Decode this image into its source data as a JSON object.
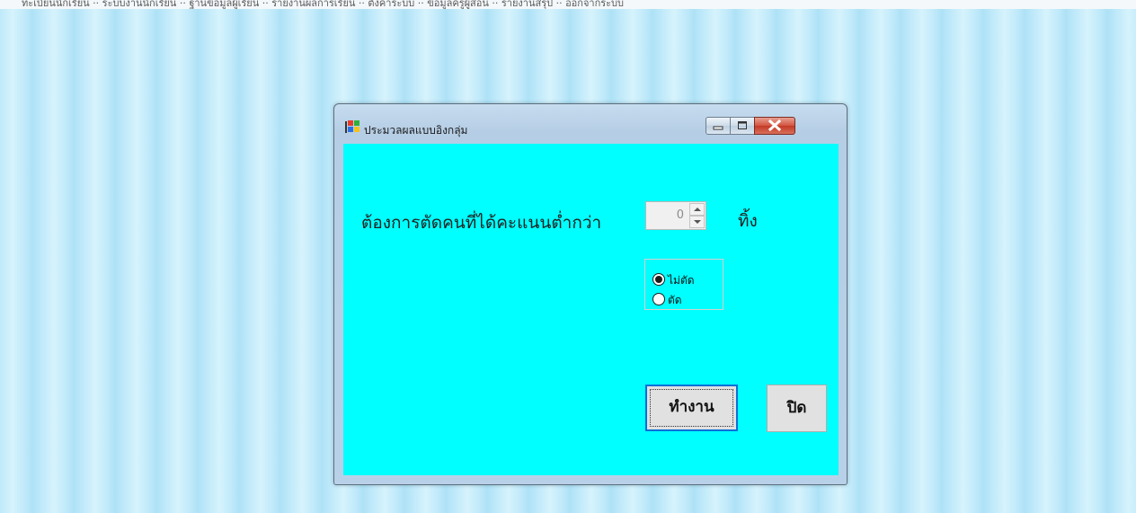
{
  "window": {
    "title": "ประมวลผลแบบอิงกลุ่ม",
    "icon": "windows-flag-icon",
    "controls": [
      "minimize-icon",
      "maximize-icon",
      "close-icon"
    ]
  },
  "form": {
    "prompt_label": "ต้องการตัดคนที่ได้คะแนนต่ำกว่า",
    "threshold_value": "0",
    "unit_label": "ทิ้ง",
    "radio_options": [
      {
        "label": "ไม่ตัด",
        "selected": true
      },
      {
        "label": "ตัด",
        "selected": false
      }
    ]
  },
  "buttons": {
    "run_label": "ทำงาน",
    "close_label": "ปิด"
  },
  "colors": {
    "client_background": "#00ffff",
    "focus_border": "#0a6fd8",
    "close_caption": "#c23a25"
  }
}
